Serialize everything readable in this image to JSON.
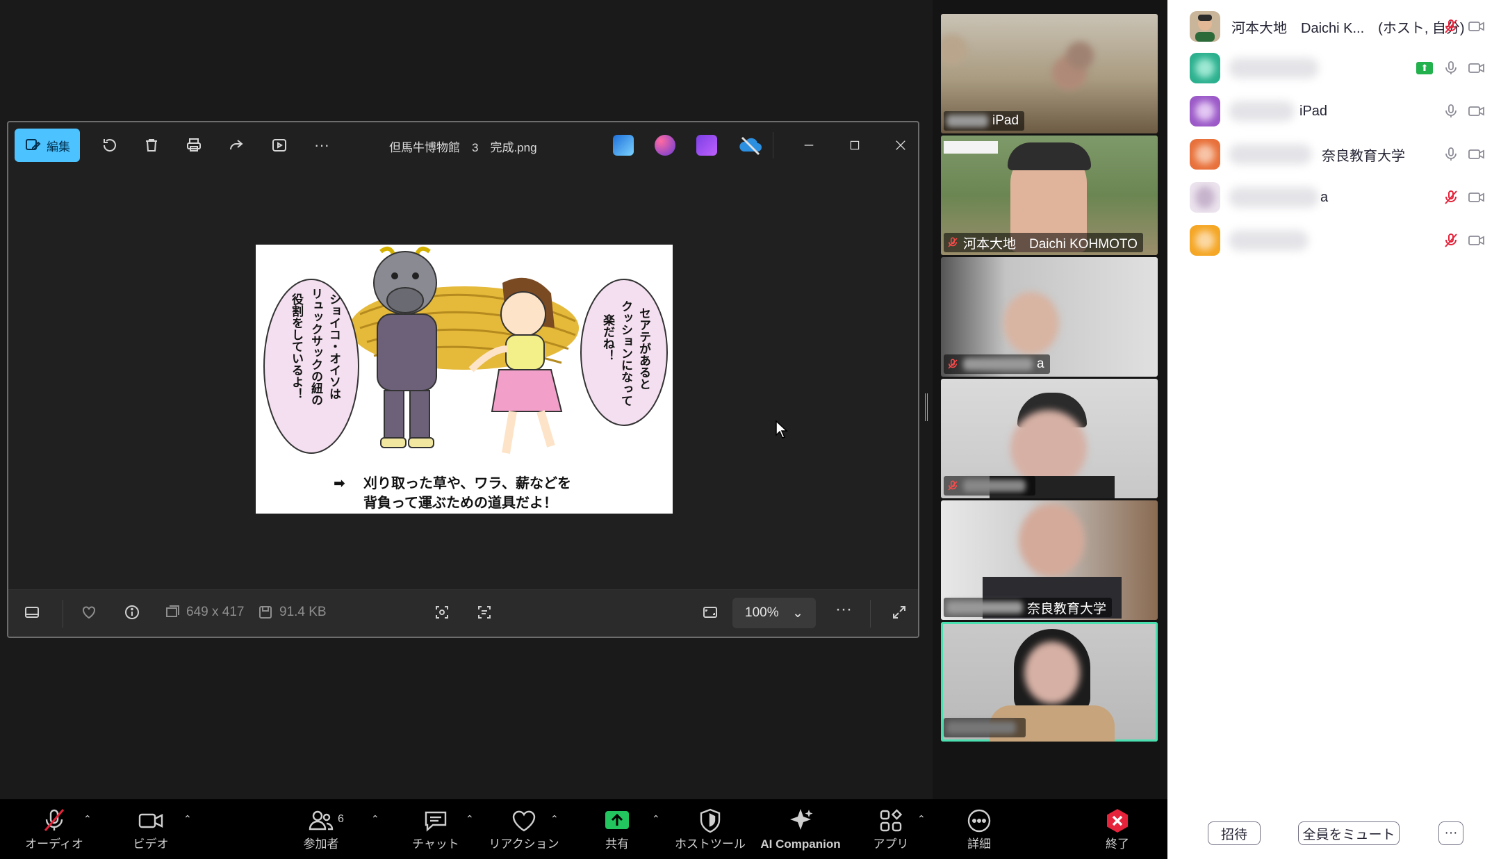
{
  "photos_window": {
    "edit_label": "編集",
    "title": "但馬牛博物館　3　完成.png",
    "dimensions": "649 x 417",
    "file_size": "91.4 KB",
    "zoom": "100%"
  },
  "image_content": {
    "left_bubble": "ショイコ・オイソは リュックサックの紐の 役割をしているよ！",
    "right_bubble": "セアテがあると クッションになって 楽だね！",
    "caption_line1": "刈り取った草や、ワラ、薪などを",
    "caption_line2": "背負って運ぶための道具だよ！"
  },
  "video_tiles": [
    {
      "name": "iPad",
      "muted": false
    },
    {
      "name": "河本大地　Daichi KOHMOTO",
      "muted": true
    },
    {
      "name": "a",
      "muted": true
    },
    {
      "name": "",
      "muted": true
    },
    {
      "name": "奈良教育大学",
      "muted": false
    },
    {
      "name": "",
      "muted": false
    }
  ],
  "participants": [
    {
      "name": "河本大地　Daichi K...",
      "role": "(ホスト, 自分)",
      "mic": "muted",
      "avatar_color": "#8b6a4e"
    },
    {
      "name": "",
      "role": "",
      "mic": "on",
      "sharing": true,
      "avatar_color": "#2bb08e"
    },
    {
      "name": "iPad",
      "role": "",
      "mic": "on",
      "avatar_color": "#9b59c8"
    },
    {
      "name": "奈良教育大学",
      "role": "",
      "mic": "on",
      "avatar_color": "#e8703a"
    },
    {
      "name": "a",
      "role": "",
      "mic": "muted",
      "avatar_color": "#d9c7dd"
    },
    {
      "name": "",
      "role": "",
      "mic": "muted",
      "avatar_color": "#f5a623"
    }
  ],
  "panel_buttons": {
    "invite": "招待",
    "mute_all": "全員をミュート",
    "more": "···"
  },
  "toolbar": {
    "audio": "オーディオ",
    "video": "ビデオ",
    "participants": "参加者",
    "participants_count": "6",
    "chat": "チャット",
    "reactions": "リアクション",
    "share": "共有",
    "host_tools": "ホストツール",
    "ai_companion": "AI Companion",
    "apps": "アプリ",
    "more": "詳細",
    "end": "終了"
  },
  "colors": {
    "accent_blue": "#4cc2ff",
    "share_green": "#22b14c",
    "active_speaker": "#4be0b0",
    "end_red": "#e5243b"
  }
}
